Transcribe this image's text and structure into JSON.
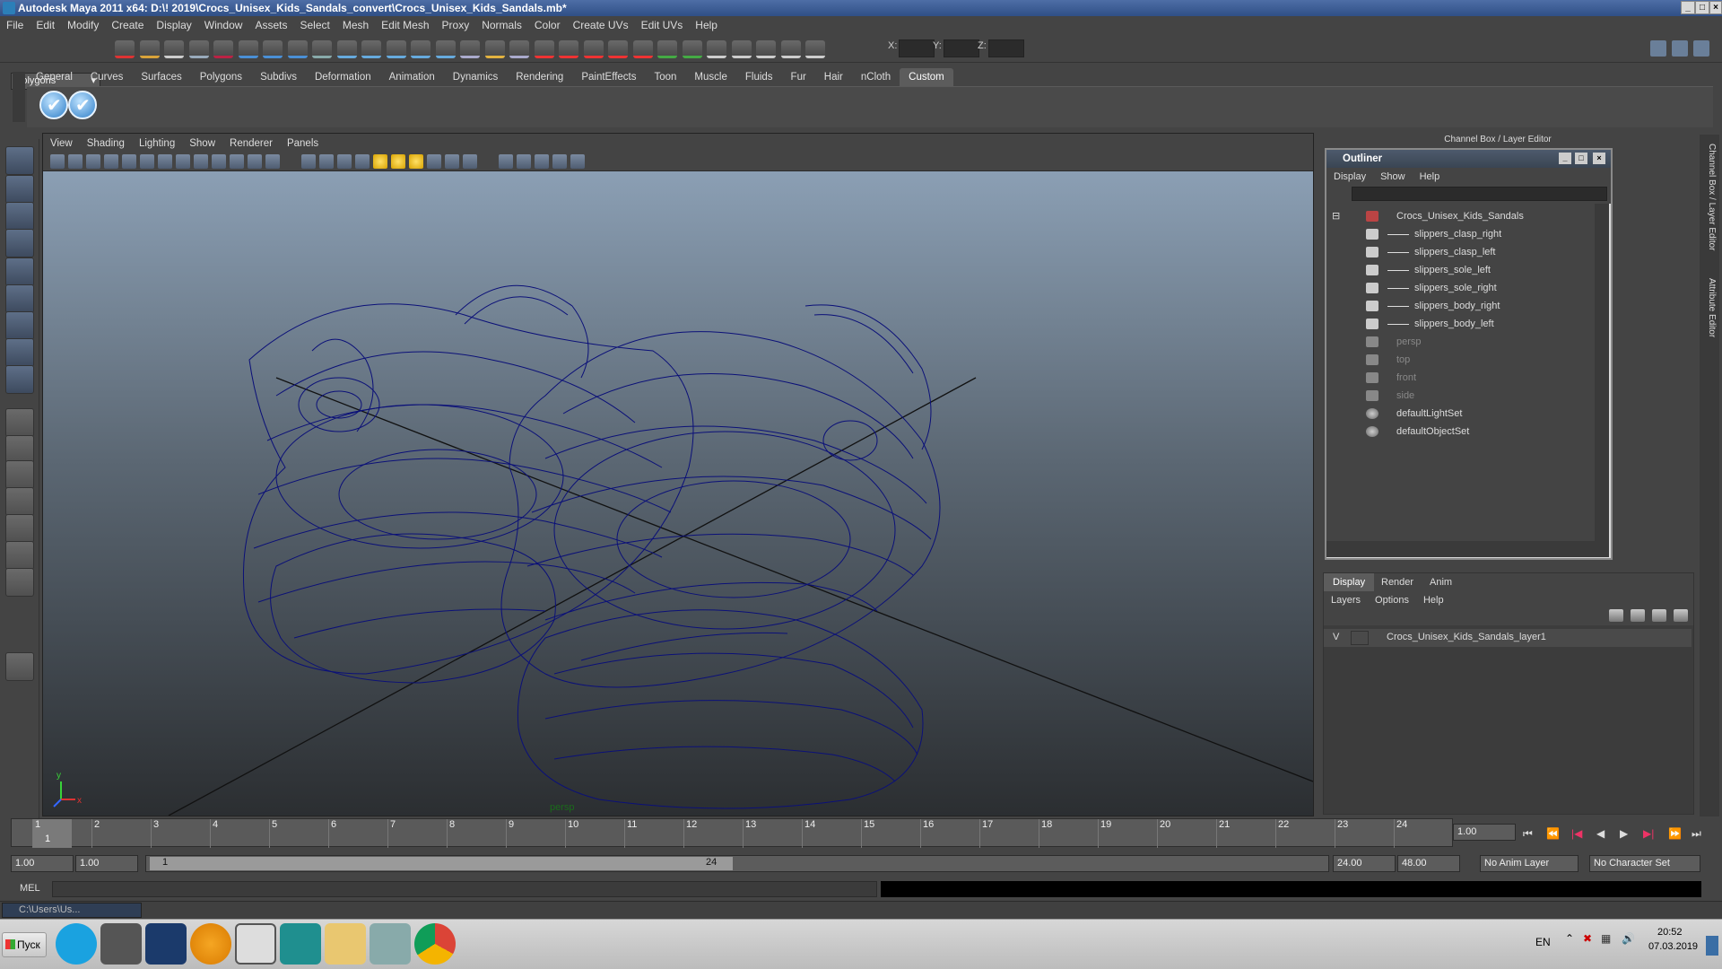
{
  "window": {
    "title": "Autodesk Maya 2011 x64: D:\\! 2019\\Crocs_Unisex_Kids_Sandals_convert\\Crocs_Unisex_Kids_Sandals.mb*"
  },
  "menubar": [
    "File",
    "Edit",
    "Modify",
    "Create",
    "Display",
    "Window",
    "Assets",
    "Select",
    "Mesh",
    "Edit Mesh",
    "Proxy",
    "Normals",
    "Color",
    "Create UVs",
    "Edit UVs",
    "Help"
  ],
  "statusline": {
    "mode": "Polygons",
    "x_label": "X:",
    "y_label": "Y:",
    "z_label": "Z:"
  },
  "shelf": {
    "tabs": [
      "General",
      "Curves",
      "Surfaces",
      "Polygons",
      "Subdivs",
      "Deformation",
      "Animation",
      "Dynamics",
      "Rendering",
      "PaintEffects",
      "Toon",
      "Muscle",
      "Fluids",
      "Fur",
      "Hair",
      "nCloth",
      "Custom"
    ],
    "active": "Custom"
  },
  "viewport": {
    "menu": [
      "View",
      "Shading",
      "Lighting",
      "Show",
      "Renderer",
      "Panels"
    ],
    "camera_label": "persp",
    "wire_color": "#0b1078"
  },
  "channel_box": {
    "title": "Channel Box / Layer Editor"
  },
  "outliner": {
    "title": "Outliner",
    "menu": [
      "Display",
      "Show",
      "Help"
    ],
    "items": [
      {
        "label": "Crocs_Unisex_Kids_Sandals",
        "level": 0,
        "dim": false,
        "icon": "group-icon"
      },
      {
        "label": "slippers_clasp_right",
        "level": 1,
        "dim": false,
        "icon": "mesh-icon"
      },
      {
        "label": "slippers_clasp_left",
        "level": 1,
        "dim": false,
        "icon": "mesh-icon"
      },
      {
        "label": "slippers_sole_left",
        "level": 1,
        "dim": false,
        "icon": "mesh-icon"
      },
      {
        "label": "slippers_sole_right",
        "level": 1,
        "dim": false,
        "icon": "mesh-icon"
      },
      {
        "label": "slippers_body_right",
        "level": 1,
        "dim": false,
        "icon": "mesh-icon"
      },
      {
        "label": "slippers_body_left",
        "level": 1,
        "dim": false,
        "icon": "mesh-icon"
      },
      {
        "label": "persp",
        "level": 0,
        "dim": true,
        "icon": "camera-icon"
      },
      {
        "label": "top",
        "level": 0,
        "dim": true,
        "icon": "camera-icon"
      },
      {
        "label": "front",
        "level": 0,
        "dim": true,
        "icon": "camera-icon"
      },
      {
        "label": "side",
        "level": 0,
        "dim": true,
        "icon": "camera-icon"
      },
      {
        "label": "defaultLightSet",
        "level": 0,
        "dim": false,
        "icon": "set-icon"
      },
      {
        "label": "defaultObjectSet",
        "level": 0,
        "dim": false,
        "icon": "set-icon"
      }
    ]
  },
  "side_tabs": [
    "Channel Box / Layer Editor",
    "Attribute Editor"
  ],
  "layer_editor": {
    "tabs": [
      "Display",
      "Render",
      "Anim"
    ],
    "active": "Display",
    "menu": [
      "Layers",
      "Options",
      "Help"
    ],
    "layers": [
      {
        "visible": "V",
        "name": "Crocs_Unisex_Kids_Sandals_layer1"
      }
    ]
  },
  "timeline": {
    "ticks": [
      "1",
      "2",
      "3",
      "4",
      "5",
      "6",
      "7",
      "8",
      "9",
      "10",
      "11",
      "12",
      "13",
      "14",
      "15",
      "16",
      "17",
      "18",
      "19",
      "20",
      "21",
      "22",
      "23",
      "24"
    ],
    "current": "1",
    "current_frame_field": "1.00"
  },
  "range": {
    "start": "1.00",
    "playback_start": "1.00",
    "slider_start": "1",
    "slider_end": "24",
    "playback_end": "24.00",
    "end": "48.00",
    "anim_layer": "No Anim Layer",
    "character_set": "No Character Set"
  },
  "mel": {
    "label": "MEL"
  },
  "minimized_window": {
    "label": "C:\\Users\\Us..."
  },
  "taskbar": {
    "start": "Пуск",
    "lang": "EN",
    "time": "20:52",
    "date": "07.03.2019"
  }
}
